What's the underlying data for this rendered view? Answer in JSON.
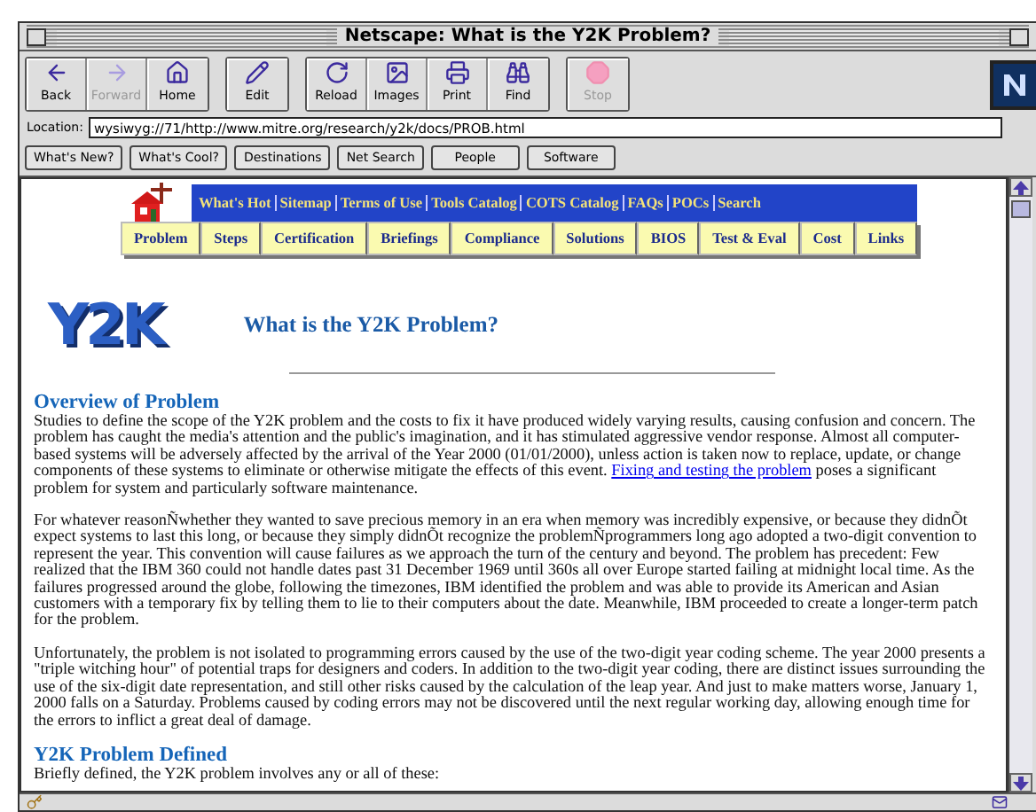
{
  "window": {
    "title": "Netscape: What is the Y2K Problem?"
  },
  "toolbar_groups": [
    [
      {
        "label": "Back",
        "kind": "back",
        "disabled": false
      },
      {
        "label": "Forward",
        "kind": "forward",
        "disabled": true
      },
      {
        "label": "Home",
        "kind": "home",
        "disabled": false
      }
    ],
    [
      {
        "label": "Edit",
        "kind": "edit",
        "disabled": false
      }
    ],
    [
      {
        "label": "Reload",
        "kind": "reload",
        "disabled": false
      },
      {
        "label": "Images",
        "kind": "images",
        "disabled": false
      },
      {
        "label": "Print",
        "kind": "print",
        "disabled": false
      },
      {
        "label": "Find",
        "kind": "find",
        "disabled": false
      }
    ],
    [
      {
        "label": "Stop",
        "kind": "stop",
        "disabled": true
      }
    ]
  ],
  "location": {
    "label": "Location:",
    "value": "wysiwyg://71/http://www.mitre.org/research/y2k/docs/PROB.html"
  },
  "directory_buttons": [
    "What's New?",
    "What's Cool?",
    "Destinations",
    "Net Search",
    "People",
    "Software"
  ],
  "site_nav": {
    "top": [
      "What's Hot",
      "Sitemap",
      "Terms of Use",
      "Tools Catalog",
      "COTS Catalog",
      "FAQs",
      "POCs",
      "Search"
    ],
    "bottom": [
      "Problem",
      "Steps",
      "Certification",
      "Briefings",
      "Compliance",
      "Solutions",
      "BIOS",
      "Test & Eval",
      "Cost",
      "Links"
    ]
  },
  "page": {
    "logo": "Y2K",
    "title": "What is the Y2K Problem?",
    "sections": [
      {
        "heading": "Overview of Problem",
        "paragraphs": [
          [
            {
              "kind": "text",
              "text": "Studies to define the scope of the Y2K problem and the costs to fix it have produced widely varying results, causing confusion and concern. The problem has caught the media's attention and the public's imagination, and it has stimulated aggressive vendor response. Almost all computer-based systems will be adversely affected by the arrival of the Year 2000 (01/01/2000), unless action is taken now to replace, update, or change components of these systems to eliminate or otherwise mitigate the effects of this event. "
            },
            {
              "kind": "link",
              "text": "Fixing and testing the problem"
            },
            {
              "kind": "text",
              "text": " poses a significant problem for system and particularly software maintenance."
            }
          ],
          [
            {
              "kind": "text",
              "text": "For whatever reasonÑwhether they wanted to save precious memory in an era when memory was incredibly expensive, or because they didnÕt expect systems to last this long, or because they simply didnÕt recognize the problemÑprogrammers long ago adopted a two-digit convention to represent the year. This convention will cause failures as we approach the turn of the century and beyond. The problem has precedent: Few realized that the IBM 360 could not handle dates past 31 December 1969 until 360s all over Europe started failing at midnight local time. As the failures progressed around the globe, following the timezones, IBM identified the problem and was able to provide its American and Asian customers with a temporary fix by telling them to lie to their computers about the date. Meanwhile, IBM proceeded to create a longer-term patch for the problem."
            }
          ],
          [
            {
              "kind": "text",
              "text": "Unfortunately, the problem is not isolated to programming errors caused by the use of the two-digit year coding scheme. The year 2000 presents a \"triple witching hour\" of potential traps for designers and coders. In addition to the two-digit year coding, there are distinct issues surrounding the use of the six-digit date representation, and still other risks caused by the calculation of the leap year. And just to make matters worse, January 1, 2000 falls on a Saturday. Problems caused by coding errors may not be discovered until the next regular working day, allowing enough time for the errors to inflict a great deal of damage."
            }
          ]
        ]
      },
      {
        "heading": "Y2K Problem Defined",
        "paragraphs": [
          [
            {
              "kind": "text",
              "text": "Briefly defined, the Y2K problem involves any or all of these:"
            }
          ]
        ]
      }
    ]
  }
}
